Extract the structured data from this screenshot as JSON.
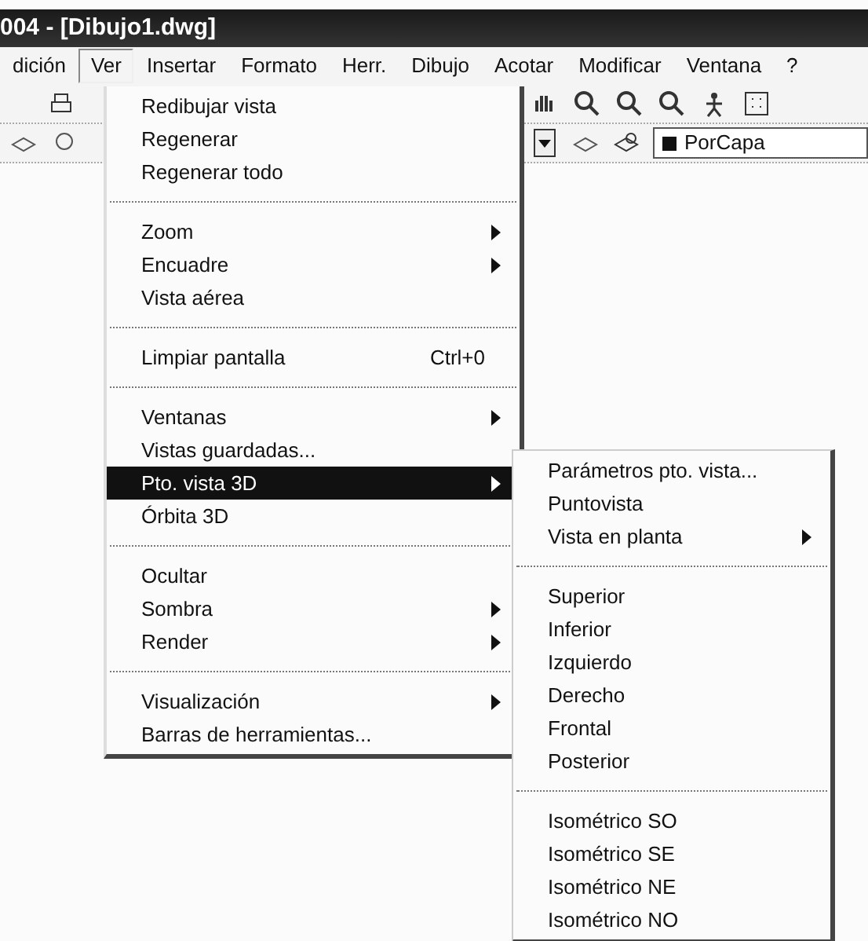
{
  "window": {
    "title": "004 - [Dibujo1.dwg]"
  },
  "menu_bar": [
    {
      "label": "dición",
      "selected": false
    },
    {
      "label": "Ver",
      "selected": true
    },
    {
      "label": "Insertar",
      "selected": false
    },
    {
      "label": "Formato",
      "selected": false
    },
    {
      "label": "Herr.",
      "selected": false
    },
    {
      "label": "Dibujo",
      "selected": false
    },
    {
      "label": "Acotar",
      "selected": false
    },
    {
      "label": "Modificar",
      "selected": false
    },
    {
      "label": "Ventana",
      "selected": false
    },
    {
      "label": "?",
      "selected": false
    }
  ],
  "layer_combo": {
    "value": "PorCapa"
  },
  "view_menu": [
    {
      "kind": "item",
      "label": "Redibujar vista",
      "submenu": false,
      "selected": false
    },
    {
      "kind": "item",
      "label": "Regenerar",
      "submenu": false,
      "selected": false
    },
    {
      "kind": "item",
      "label": "Regenerar todo",
      "submenu": false,
      "selected": false
    },
    {
      "kind": "separator"
    },
    {
      "kind": "item",
      "label": "Zoom",
      "submenu": true,
      "selected": false
    },
    {
      "kind": "item",
      "label": "Encuadre",
      "submenu": true,
      "selected": false
    },
    {
      "kind": "item",
      "label": "Vista aérea",
      "submenu": false,
      "selected": false
    },
    {
      "kind": "separator"
    },
    {
      "kind": "item",
      "label": "Limpiar pantalla",
      "shortcut": "Ctrl+0",
      "submenu": false,
      "selected": false
    },
    {
      "kind": "separator"
    },
    {
      "kind": "item",
      "label": "Ventanas",
      "submenu": true,
      "selected": false
    },
    {
      "kind": "item",
      "label": "Vistas guardadas...",
      "submenu": false,
      "selected": false
    },
    {
      "kind": "item",
      "label": "Pto. vista 3D",
      "submenu": true,
      "selected": true
    },
    {
      "kind": "item",
      "label": "Órbita 3D",
      "submenu": false,
      "selected": false
    },
    {
      "kind": "separator"
    },
    {
      "kind": "item",
      "label": "Ocultar",
      "submenu": false,
      "selected": false
    },
    {
      "kind": "item",
      "label": "Sombra",
      "submenu": true,
      "selected": false
    },
    {
      "kind": "item",
      "label": "Render",
      "submenu": true,
      "selected": false
    },
    {
      "kind": "separator"
    },
    {
      "kind": "item",
      "label": "Visualización",
      "submenu": true,
      "selected": false
    },
    {
      "kind": "item",
      "label": "Barras de herramientas...",
      "submenu": false,
      "selected": false
    }
  ],
  "viewpoint_submenu": [
    {
      "kind": "item",
      "label": "Parámetros pto. vista...",
      "submenu": false,
      "selected": false
    },
    {
      "kind": "item",
      "label": "Puntovista",
      "submenu": false,
      "selected": false
    },
    {
      "kind": "item",
      "label": "Vista en planta",
      "submenu": true,
      "selected": false
    },
    {
      "kind": "separator"
    },
    {
      "kind": "item",
      "label": "Superior",
      "submenu": false,
      "selected": false
    },
    {
      "kind": "item",
      "label": "Inferior",
      "submenu": false,
      "selected": false
    },
    {
      "kind": "item",
      "label": "Izquierdo",
      "submenu": false,
      "selected": false
    },
    {
      "kind": "item",
      "label": "Derecho",
      "submenu": false,
      "selected": false
    },
    {
      "kind": "item",
      "label": "Frontal",
      "submenu": false,
      "selected": false
    },
    {
      "kind": "item",
      "label": "Posterior",
      "submenu": false,
      "selected": false
    },
    {
      "kind": "separator"
    },
    {
      "kind": "item",
      "label": "Isométrico SO",
      "submenu": false,
      "selected": false
    },
    {
      "kind": "item",
      "label": "Isométrico SE",
      "submenu": false,
      "selected": false
    },
    {
      "kind": "item",
      "label": "Isométrico NE",
      "submenu": false,
      "selected": false
    },
    {
      "kind": "item",
      "label": "Isométrico NO",
      "submenu": false,
      "selected": false
    }
  ]
}
